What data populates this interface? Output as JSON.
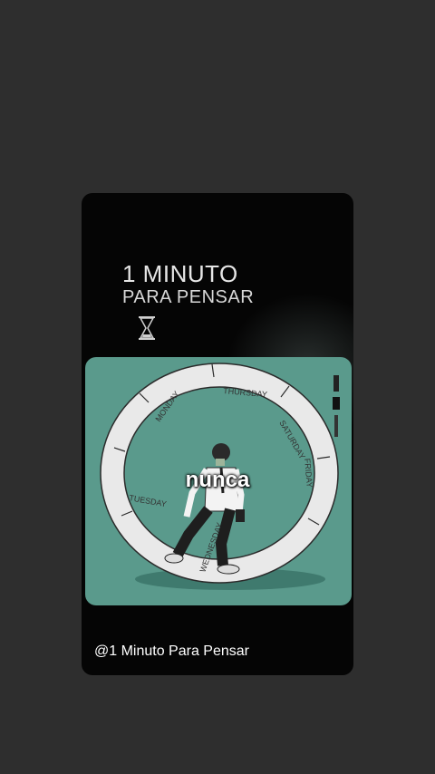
{
  "app": {
    "title_line1": "1 MINUTO",
    "title_line2": "PARA PENSAR",
    "caption_word": "nunca",
    "channel_handle": "@1 Minuto Para Pensar"
  },
  "wheel_labels": [
    "MONDAY",
    "TUESDAY",
    "WEDNESDAY",
    "THURSDAY",
    "FRIDAY",
    "SATURDAY"
  ],
  "icons": {
    "hourglass": "hourglass-icon",
    "wheel": "hamster-wheel-illustration"
  },
  "colors": {
    "page_background": "#2e2e2e",
    "card_background": "#050505",
    "panel_background": "#5a9a8c",
    "text": "#ffffff"
  }
}
